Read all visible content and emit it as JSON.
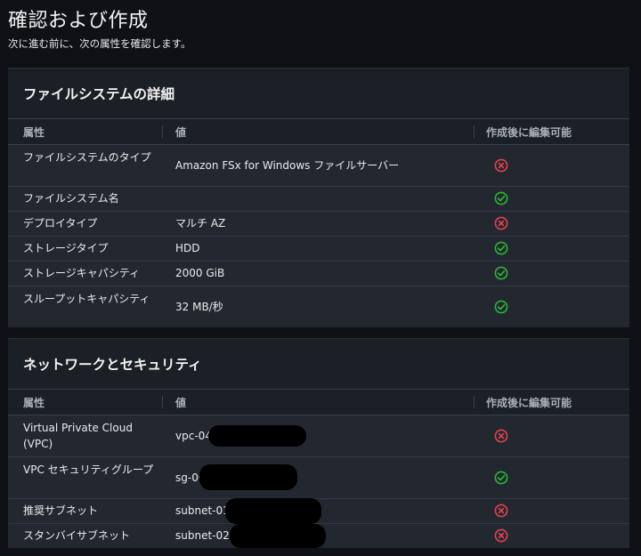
{
  "header": {
    "title": "確認および作成",
    "subtitle": "次に進む前に、次の属性を確認します。"
  },
  "columns": {
    "attribute": "属性",
    "value": "値",
    "editable": "作成後に編集可能"
  },
  "fs_panel": {
    "title": "ファイルシステムの詳細",
    "rows": [
      {
        "attr": "ファイルシステムのタイプ",
        "value": "Amazon FSx for Windows ファイルサーバー",
        "editable": false
      },
      {
        "attr": "ファイルシステム名",
        "value": "",
        "editable": true
      },
      {
        "attr": "デプロイタイプ",
        "value": "マルチ AZ",
        "editable": false
      },
      {
        "attr": "ストレージタイプ",
        "value": "HDD",
        "editable": true
      },
      {
        "attr": "ストレージキャパシティ",
        "value": "2000 GiB",
        "editable": true
      },
      {
        "attr": "スループットキャパシティ",
        "value": "32 MB/秒",
        "editable": true
      }
    ]
  },
  "net_panel": {
    "title": "ネットワークとセキュリティ",
    "rows": [
      {
        "attr": "Virtual Private Cloud (VPC)",
        "value": "vpc-04",
        "editable": false
      },
      {
        "attr": "VPC セキュリティグループ",
        "value": "sg-00",
        "editable": true
      },
      {
        "attr": "推奨サブネット",
        "value": "subnet-01",
        "editable": false
      },
      {
        "attr": "スタンバイサブネット",
        "value": "subnet-026",
        "editable": false
      }
    ]
  },
  "colors": {
    "ok": "#2bb534",
    "no": "#e0434f"
  },
  "icons": {
    "ok": "check-circle-icon",
    "no": "x-circle-icon"
  }
}
